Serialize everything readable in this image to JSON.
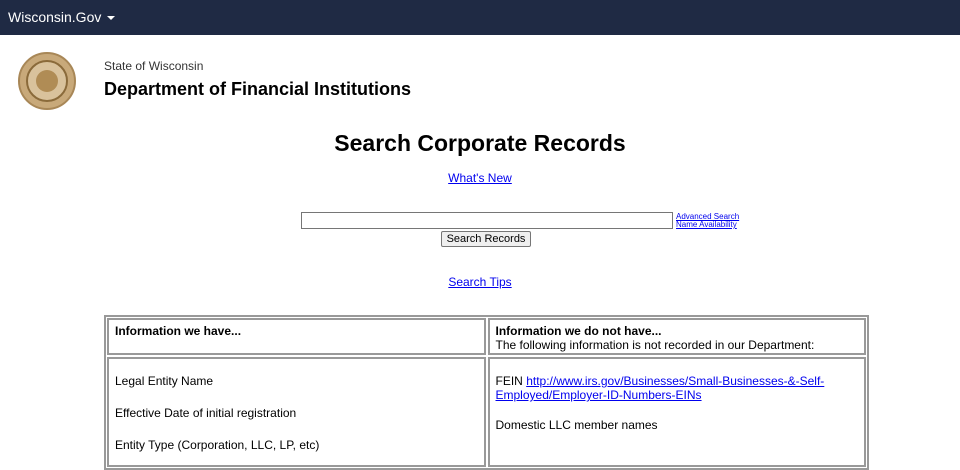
{
  "topbar": {
    "brand": "Wisconsin.Gov"
  },
  "header": {
    "state": "State of Wisconsin",
    "department": "Department of Financial Institutions"
  },
  "page": {
    "title": "Search Corporate Records",
    "whats_new": "What's New",
    "search_tips": "Search Tips"
  },
  "search": {
    "value": "",
    "button": "Search Records",
    "advanced": "Advanced Search",
    "name_availability": "Name Availability"
  },
  "table": {
    "have_header": "Information we have...",
    "not_have_header": "Information we do not have...",
    "not_have_sub": "The following information is not recorded in our Department:",
    "have_items": [
      "Legal Entity Name",
      "Effective Date of initial registration",
      "Entity Type (Corporation, LLC, LP, etc)"
    ],
    "fein_label": "FEIN",
    "fein_link": "http://www.irs.gov/Businesses/Small-Businesses-&-Self-Employed/Employer-ID-Numbers-EINs",
    "not_have_item2": "Domestic LLC member names"
  }
}
